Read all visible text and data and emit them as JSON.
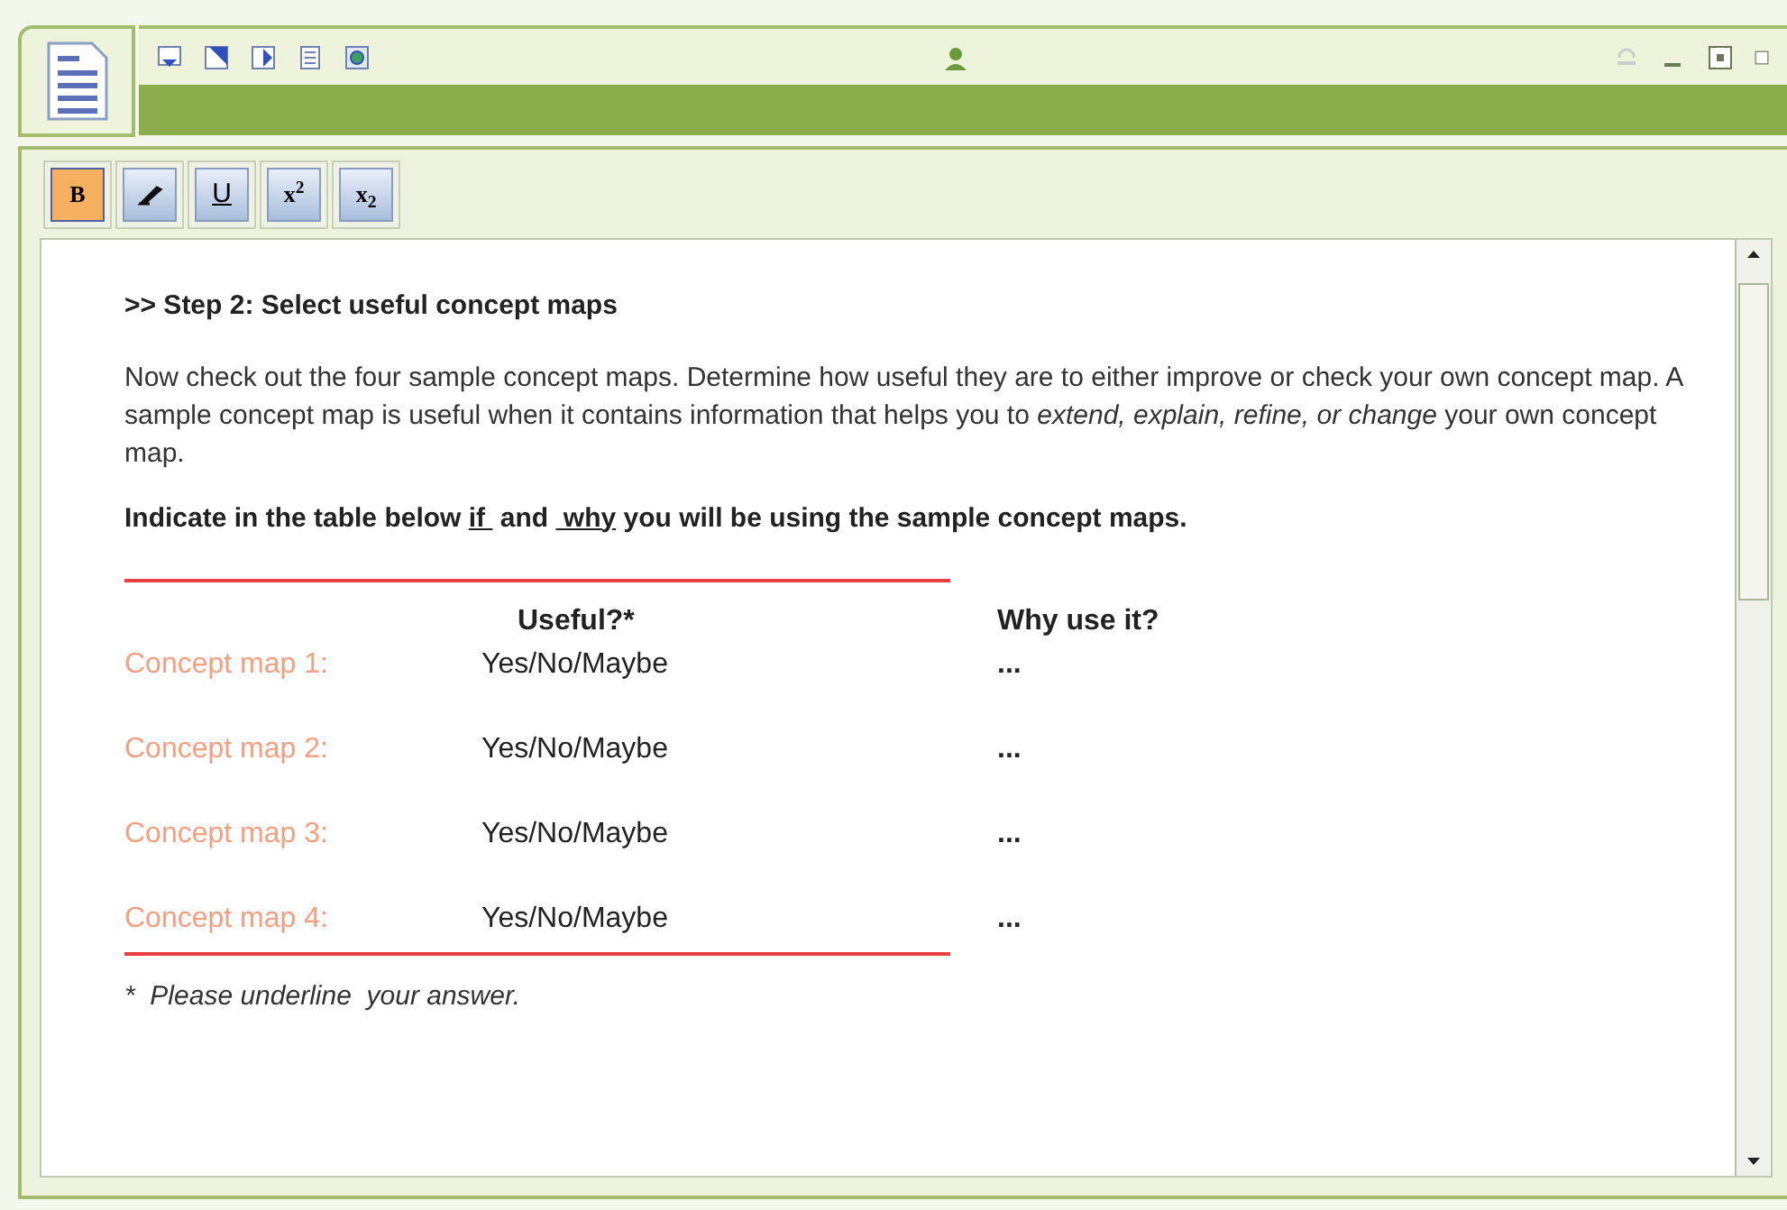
{
  "format_toolbar": [
    {
      "kind": "text",
      "label": "B",
      "selected": true
    },
    {
      "kind": "italic",
      "selected": false
    },
    {
      "kind": "underline",
      "label": "U",
      "selected": false
    },
    {
      "kind": "text",
      "label": "x$^{2}$",
      "selected": false
    },
    {
      "kind": "text",
      "label": "x$_{2}$",
      "selected": false
    }
  ],
  "content": {
    "heading": ">> Step 2: Select useful concept maps",
    "paragraph": "Now check out the four sample concept maps. Determine how useful they are to either improve or check your own concept map. A sample concept map is useful when  it contains information that helps you to *extend, explain, refine, or change* your own concept map.",
    "instruction": [
      {
        "text": "Indicate in the table below ",
        "underlined": false
      },
      {
        "text": "if ",
        "underlined": true
      },
      {
        "text": " and ",
        "underlined": false
      },
      {
        "text": " why",
        "underlined": true
      },
      {
        "text": " you will be using the sample concept maps.",
        "underlined": false
      }
    ],
    "table": {
      "columns": [
        "Useful?*",
        "Why use it?"
      ],
      "rows": [
        {
          "label": "Concept map 1:",
          "useful": "Yes/No/Maybe",
          "why": "..."
        },
        {
          "label": "Concept map 2:",
          "useful": "Yes/No/Maybe",
          "why": "..."
        },
        {
          "label": "Concept map 3:",
          "useful": "Yes/No/Maybe",
          "why": "..."
        },
        {
          "label": "Concept map 4:",
          "useful": "Yes/No/Maybe",
          "why": "..."
        }
      ]
    },
    "footnote": "*  Please underline  your answer."
  }
}
